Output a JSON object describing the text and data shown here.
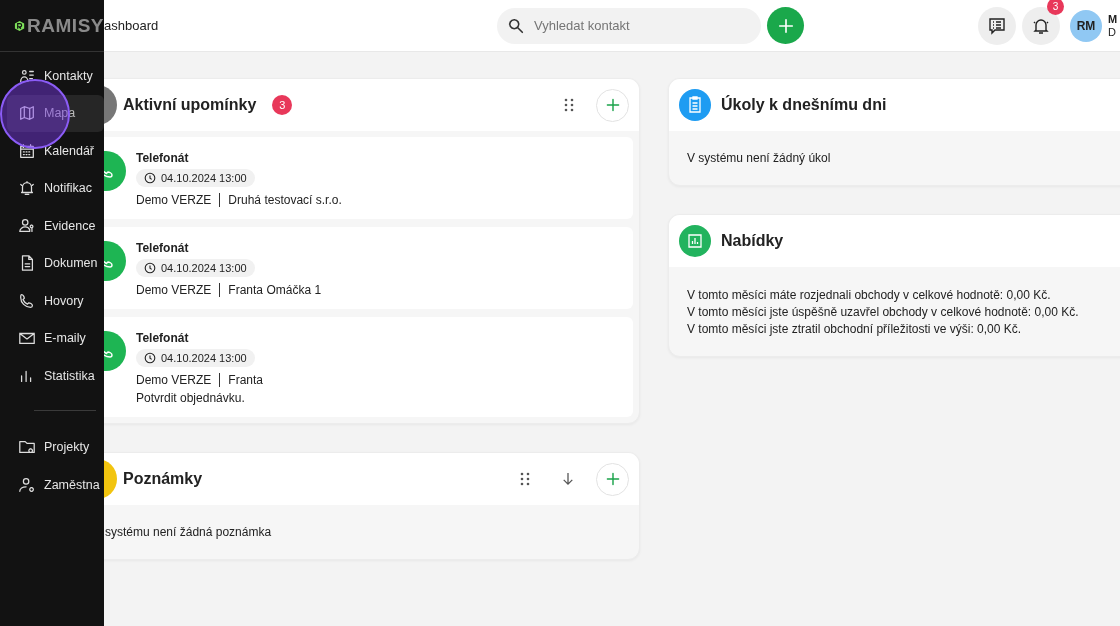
{
  "sidebar": {
    "logo": "RAMISY",
    "items": [
      {
        "label": "Kontakty",
        "selected": false
      },
      {
        "label": "Mapa",
        "selected": true
      },
      {
        "label": "Kalendář",
        "selected": false
      },
      {
        "label": "Notifikac",
        "selected": false
      },
      {
        "label": "Evidence",
        "selected": false
      },
      {
        "label": "Dokumen",
        "selected": false
      },
      {
        "label": "Hovory",
        "selected": false
      },
      {
        "label": "E-maily",
        "selected": false
      },
      {
        "label": "Statistika",
        "selected": false
      }
    ],
    "bottom_items": [
      {
        "label": "Projekty",
        "selected": false
      },
      {
        "label": "Zaměstna",
        "selected": false
      }
    ]
  },
  "header": {
    "breadcrumb": "ashboard",
    "search": {
      "placeholder": "Vyhledat kontakt"
    },
    "notification_count": "3",
    "user": {
      "initials": "RM",
      "name": "M",
      "subtitle": "D"
    }
  },
  "reminders": {
    "title": "Aktivní upomínky",
    "count": "3",
    "items": [
      {
        "title": "Telefonát",
        "datetime": "04.10.2024 13:00",
        "company": "Demo VERZE",
        "contact": "Druhá testovací s.r.o."
      },
      {
        "title": "Telefonát",
        "datetime": "04.10.2024 13:00",
        "company": "Demo VERZE",
        "contact": "Franta Omáčka 1"
      },
      {
        "title": "Telefonát",
        "datetime": "04.10.2024 13:00",
        "company": "Demo VERZE",
        "contact": "Franta",
        "note": "Potvrdit objednávku."
      }
    ]
  },
  "notes": {
    "title": "Poznámky",
    "empty": "systému není žádná poznámka"
  },
  "tasks": {
    "title": "Úkoly k dnešnímu dni",
    "empty": "V systému není žádný úkol"
  },
  "offers": {
    "title": "Nabídky",
    "lines": [
      "V tomto měsíci máte rozjednali obchody v celkové hodnotě: 0,00 Kč.",
      "V tomto měsíci jste úspěšně uzavřel obchody v celkové hodnotě: 0,00 Kč.",
      "V tomto měsíci jste ztratil obchodní příležitosti ve výši: 0,00 Kč."
    ]
  }
}
